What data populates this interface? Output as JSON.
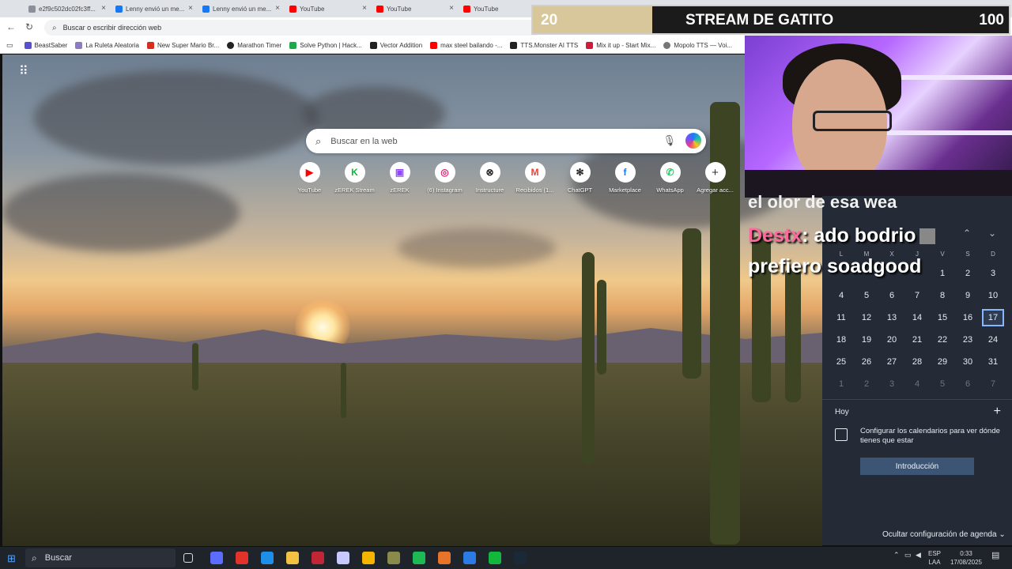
{
  "tabs": [
    {
      "title": "e2f9c502dc02fc3ff...",
      "color": "#8a8f99"
    },
    {
      "title": "Lenny envió un me...",
      "color": "#1877f2"
    },
    {
      "title": "Lenny envió un me...",
      "color": "#1877f2"
    },
    {
      "title": "YouTube",
      "color": "#ff0000"
    },
    {
      "title": "YouTube",
      "color": "#ff0000"
    },
    {
      "title": "YouTube",
      "color": "#ff0000"
    }
  ],
  "address": {
    "placeholder": "Buscar o escribir dirección web"
  },
  "bookmarks": [
    {
      "label": "BeastSaber",
      "color": "#5a4fcf"
    },
    {
      "label": "La Ruleta Aleatoria",
      "color": "#8e7cc3"
    },
    {
      "label": "New Super Mario Br...",
      "color": "#d62d20"
    },
    {
      "label": "Marathon Timer",
      "color": "#222222"
    },
    {
      "label": "Solve Python | Hack...",
      "color": "#1ba94c"
    },
    {
      "label": "Vector Addition",
      "color": "#222222"
    },
    {
      "label": "max steel bailando -...",
      "color": "#ff0000"
    },
    {
      "label": "TTS.Monster AI TTS",
      "color": "#222222"
    },
    {
      "label": "Mix it up - Start Mix...",
      "color": "#d11a3a"
    },
    {
      "label": "Mopolo TTS — Voi...",
      "color": "#777777"
    }
  ],
  "search": {
    "placeholder": "Buscar en la web"
  },
  "shortcuts": [
    {
      "label": "YouTube",
      "glyph": "▶",
      "color": "#ff0000"
    },
    {
      "label": "zEREK Stream",
      "glyph": "K",
      "color": "#12b83c"
    },
    {
      "label": "zEREK",
      "glyph": "▣",
      "color": "#9146ff"
    },
    {
      "label": "(6) Instagram",
      "glyph": "◎",
      "color": "#d62976"
    },
    {
      "label": "Instructure",
      "glyph": "⊗",
      "color": "#222222"
    },
    {
      "label": "Recibidos (1...",
      "glyph": "M",
      "color": "#ea4335"
    },
    {
      "label": "ChatGPT",
      "glyph": "✻",
      "color": "#222222"
    },
    {
      "label": "Marketplace",
      "glyph": "f",
      "color": "#1877f2"
    },
    {
      "label": "WhatsApp",
      "glyph": "✆",
      "color": "#25d366"
    },
    {
      "label": "Agregar acc...",
      "glyph": "+",
      "color": "#333333"
    }
  ],
  "stream_bar": {
    "min": "20",
    "title": "STREAM DE GATITO",
    "max": "100",
    "progress": 0.25
  },
  "chat": {
    "partial": "el olor de esa wea",
    "user": "Destx",
    "message": ": ado bodrio",
    "message2": "prefiero soadgood"
  },
  "calendar": {
    "weekdays": [
      "L",
      "M",
      "X",
      "J",
      "V",
      "S",
      "D"
    ],
    "weeks": [
      [
        "",
        "",
        "",
        "",
        "1",
        "2",
        "3"
      ],
      [
        "4",
        "5",
        "6",
        "7",
        "8",
        "9",
        "10"
      ],
      [
        "11",
        "12",
        "13",
        "14",
        "15",
        "16",
        "17"
      ],
      [
        "18",
        "19",
        "20",
        "21",
        "22",
        "23",
        "24"
      ],
      [
        "25",
        "26",
        "27",
        "28",
        "29",
        "30",
        "31"
      ],
      [
        "1",
        "2",
        "3",
        "4",
        "5",
        "6",
        "7"
      ]
    ],
    "selected": "17",
    "today_label": "Hoy",
    "message": "Configurar los calendarios para ver dónde tienes que estar",
    "button": "Introducción",
    "hide_label": "Ocultar configuración de agenda"
  },
  "taskbar": {
    "search_label": "Buscar",
    "lang_top": "ESP",
    "lang_bottom": "LAA",
    "time": "0:33",
    "date": "17/08/2025",
    "apps": [
      "#5b6cff",
      "#e2332a",
      "#1f8ee6",
      "#f3c242",
      "#c12636",
      "#c6c8ff",
      "#f4b400",
      "#8a8a4a",
      "#1db954",
      "#e8742a",
      "#2c7be5",
      "#12b83c",
      "#1b2838"
    ]
  }
}
